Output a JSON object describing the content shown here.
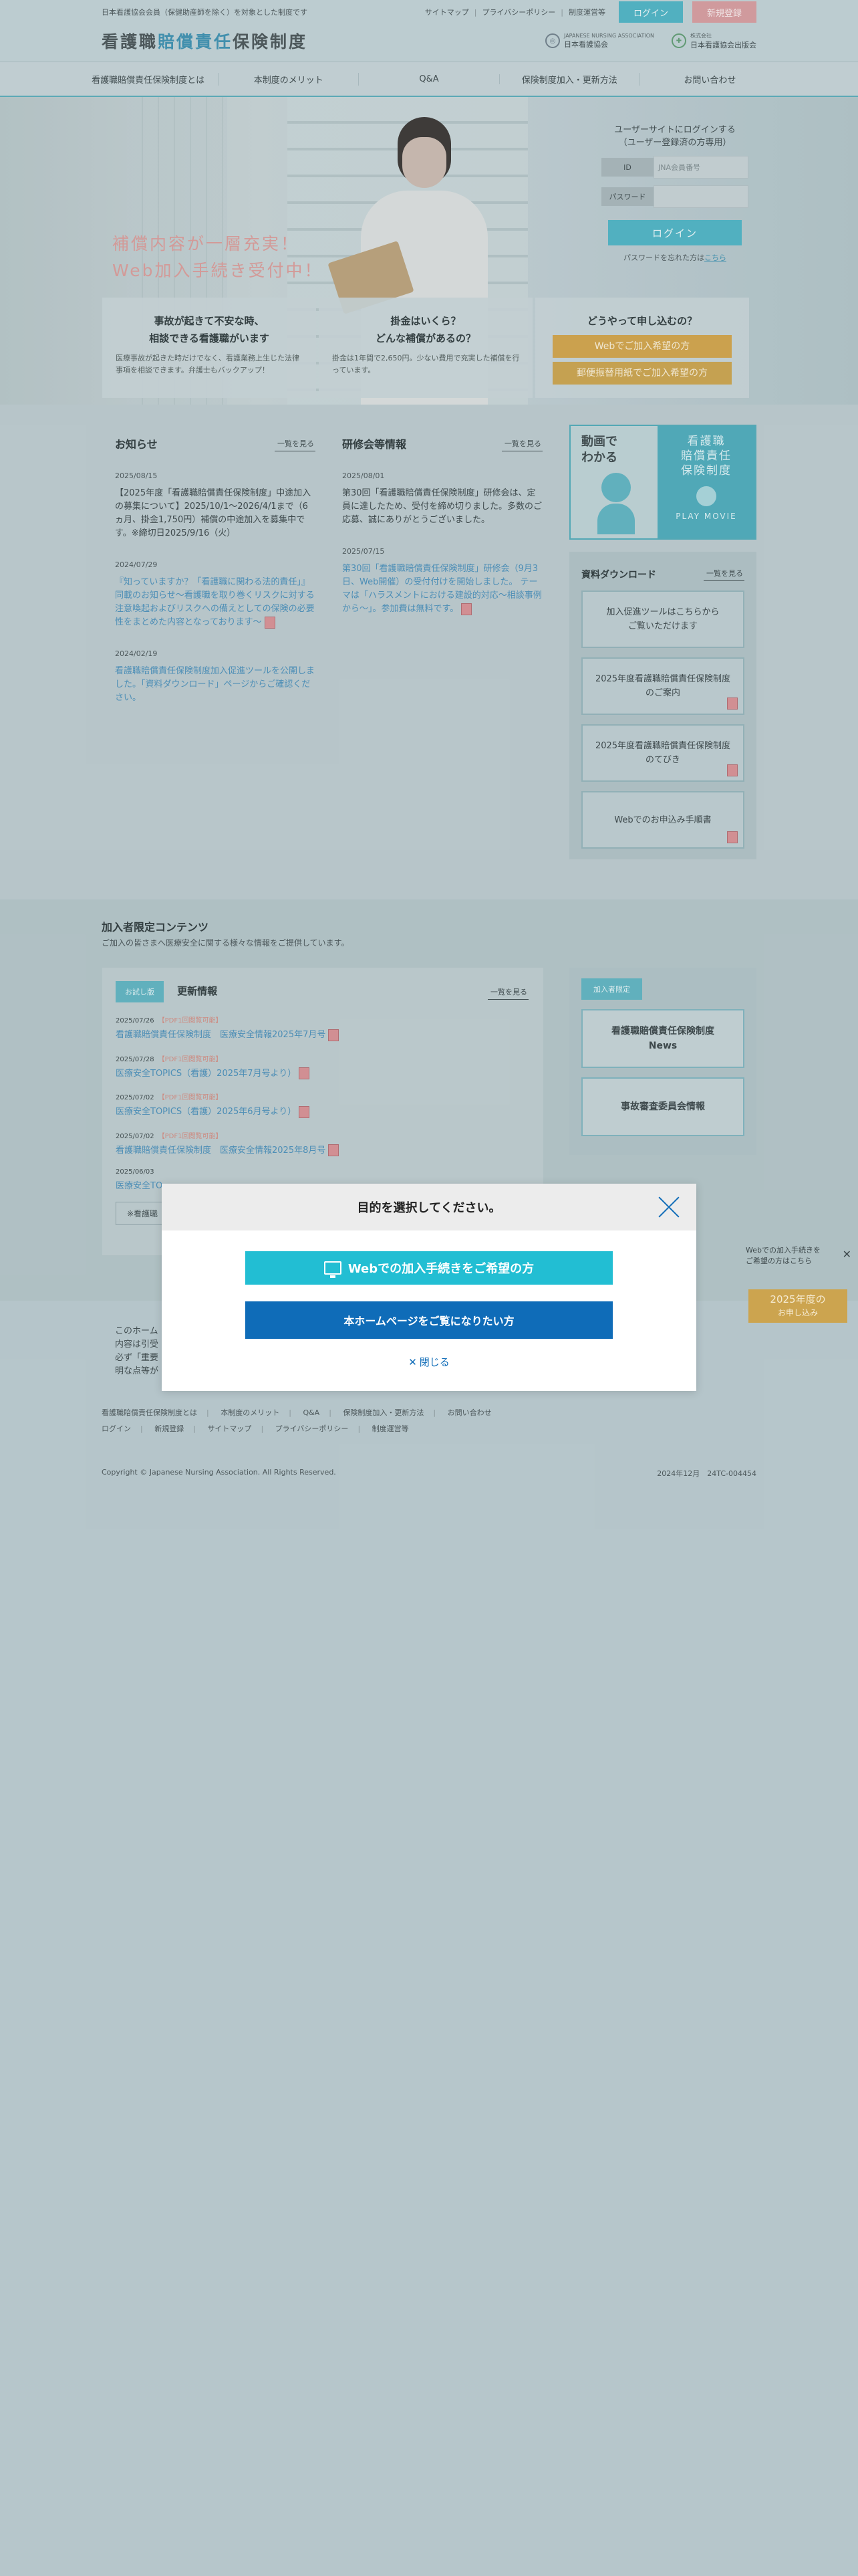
{
  "header": {
    "note": "日本看護協会会員（保健助産師を除く）を対象とした制度です",
    "links": [
      "サイトマップ",
      "プライバシーポリシー",
      "制度運営等"
    ],
    "login_label": "ログイン",
    "register_label": "新規登録",
    "logo_part1": "看護職",
    "logo_part2": "賠償責任",
    "logo_part3": "保険制度",
    "org1_small": "JAPANESE NURSING ASSOCIATION",
    "org1_name": "日本看護協会",
    "org2_small": "株式会社",
    "org2_name": "日本看護協会出版会"
  },
  "nav": [
    "看護職賠償責任保険制度とは",
    "本制度のメリット",
    "Q&A",
    "保険制度加入・更新方法",
    "お問い合わせ"
  ],
  "hero": {
    "catch_line1": "補償内容が一層充実！",
    "catch_line2": "Web加入手続き受付中！",
    "login_title_line1": "ユーザーサイトにログインする",
    "login_title_line2": "（ユーザー登録済の方専用）",
    "id_label": "ID",
    "id_placeholder": "JNA会員番号",
    "pw_label": "パスワード",
    "login_button": "ログイン",
    "forgot_text": "パスワードを忘れた方は",
    "forgot_link": "こちら",
    "cards": [
      {
        "title1": "事故が起きて不安な時、",
        "title2": "相談できる看護職がいます",
        "body": "医療事故が起きた時だけでなく、看護業務上生じた法律事項を相談できます。弁護士もバックアップ！"
      },
      {
        "title1": "掛金はいくら？",
        "title2": "どんな補償があるの？",
        "body": "掛金は1年間で2,650円。少ない費用で充実した補償を行っています。"
      },
      {
        "title1": "どうやって申し込むの？",
        "btn_web": "Webでご加入希望の方",
        "btn_post": "郵便振替用紙でご加入希望の方"
      }
    ]
  },
  "news": {
    "title": "お知らせ",
    "more": "一覧を見る",
    "items": [
      {
        "date": "2025/08/15",
        "text": "【2025年度「看護職賠償責任保険制度」中途加入の募集について】2025/10/1〜2026/4/1まで（6ヵ月、掛金1,750円）補償の中途加入を募集中です。※締切日2025/9/16（火）"
      },
      {
        "date": "2024/07/29",
        "text": "『知っていますか？「看護職に関わる法的責任」』同載のお知らせ〜看護職を取り巻くリスクに対する注意喚起およびリスクへの備えとしての保険の必要性をまとめた内容となっております〜"
      },
      {
        "date": "2024/02/19",
        "text": "看護職賠償責任保険制度加入促進ツールを公開しました。「資料ダウンロード」ページからご確認ください。"
      }
    ]
  },
  "kenshu": {
    "title": "研修会等情報",
    "more": "一覧を見る",
    "items": [
      {
        "date": "2025/08/01",
        "text": "第30回「看護職賠償責任保険制度」研修会は、定員に達したため、受付を締め切りました。多数のご応募、誠にありがとうございました。"
      },
      {
        "date": "2025/07/15",
        "text": "第30回「看護職賠償責任保険制度」研修会（9月3日、Web開催）の受付付けを開始しました。 テーマは「ハラスメントにおける建設的対応〜相談事例から〜」。参加費は無料です。"
      }
    ]
  },
  "movie": {
    "left_line1": "動画で",
    "left_line2": "わかる",
    "right_line1": "看護職",
    "right_line2": "賠償責任",
    "right_line3": "保険制度",
    "play": "PLAY MOVIE"
  },
  "download": {
    "title": "資料ダウンロード",
    "more": "一覧を見る",
    "items": [
      {
        "line1": "加入促進ツールはこちらから",
        "line2": "ご覧いただけます"
      },
      {
        "line1": "2025年度看護職賠償責任保険制度",
        "line2": "のご案内"
      },
      {
        "line1": "2025年度看護職賠償責任保険制度",
        "line2": "のてびき"
      },
      {
        "line1": "Webでのお申込み手順書",
        "line2": ""
      }
    ]
  },
  "members": {
    "title": "加入者限定コンテンツ",
    "subtitle": "ご加入の皆さまへ医療安全に関する様々な情報をご提供しています。",
    "trial_badge": "お試し版",
    "updates_title": "更新情報",
    "more": "一覧を見る",
    "updates": [
      {
        "date": "2025/07/26",
        "tag": "【PDF1回閲覧可能】",
        "text": "看護職賠償責任保険制度　医療安全情報2025年7月号"
      },
      {
        "date": "2025/07/28",
        "tag": "【PDF1回閲覧可能】",
        "text": "医療安全TOPICS（看護）2025年7月号より）"
      },
      {
        "date": "2025/07/02",
        "tag": "【PDF1回閲覧可能】",
        "text": "医療安全TOPICS（看護）2025年6月号より）"
      },
      {
        "date": "2025/07/02",
        "tag": "【PDF1回閲覧可能】",
        "text": "看護職賠償責任保険制度　医療安全情報2025年8月号"
      },
      {
        "date": "2025/06/03",
        "tag": "",
        "text": "医療安全TO"
      }
    ],
    "more_btn": "※看護職",
    "side_badge": "加入者限定",
    "side_items": [
      {
        "line1": "看護職賠償責任保険制度",
        "line2": "News"
      },
      {
        "line1": "事故審査委員会情報",
        "line2": ""
      }
    ]
  },
  "footer": {
    "note1": "このホーム",
    "note2": "内容は引受",
    "note3": "必ず「重要",
    "note4": "明な点等が",
    "links_row1": [
      "看護職賠償責任保険制度とは",
      "本制度のメリット",
      "Q&A",
      "保険制度加入・更新方法",
      "お問い合わせ"
    ],
    "links_row2": [
      "ログイン",
      "新規登録",
      "サイトマップ",
      "プライバシーポリシー",
      "制度運営等"
    ],
    "copyright": "Copyright © Japanese Nursing Association. All Rights Reserved.",
    "code": "2024年12月　24TC-004454"
  },
  "modal": {
    "title": "目的を選択してください。",
    "btn_web": "Webでの加入手続きをご希望の方",
    "btn_home": "本ホームページをご覧になりたい方",
    "close": "閉じる"
  },
  "float": {
    "note_line1": "Webでの加入手続きを",
    "note_line2": "ご希望の方はこちら",
    "btn_line1": "2025年度の",
    "btn_line2": "お申し込み"
  },
  "colors": {
    "accent": "#22bed3",
    "primary": "#0f6cb8",
    "gold": "#cca44f",
    "pink": "#d49a9d"
  }
}
